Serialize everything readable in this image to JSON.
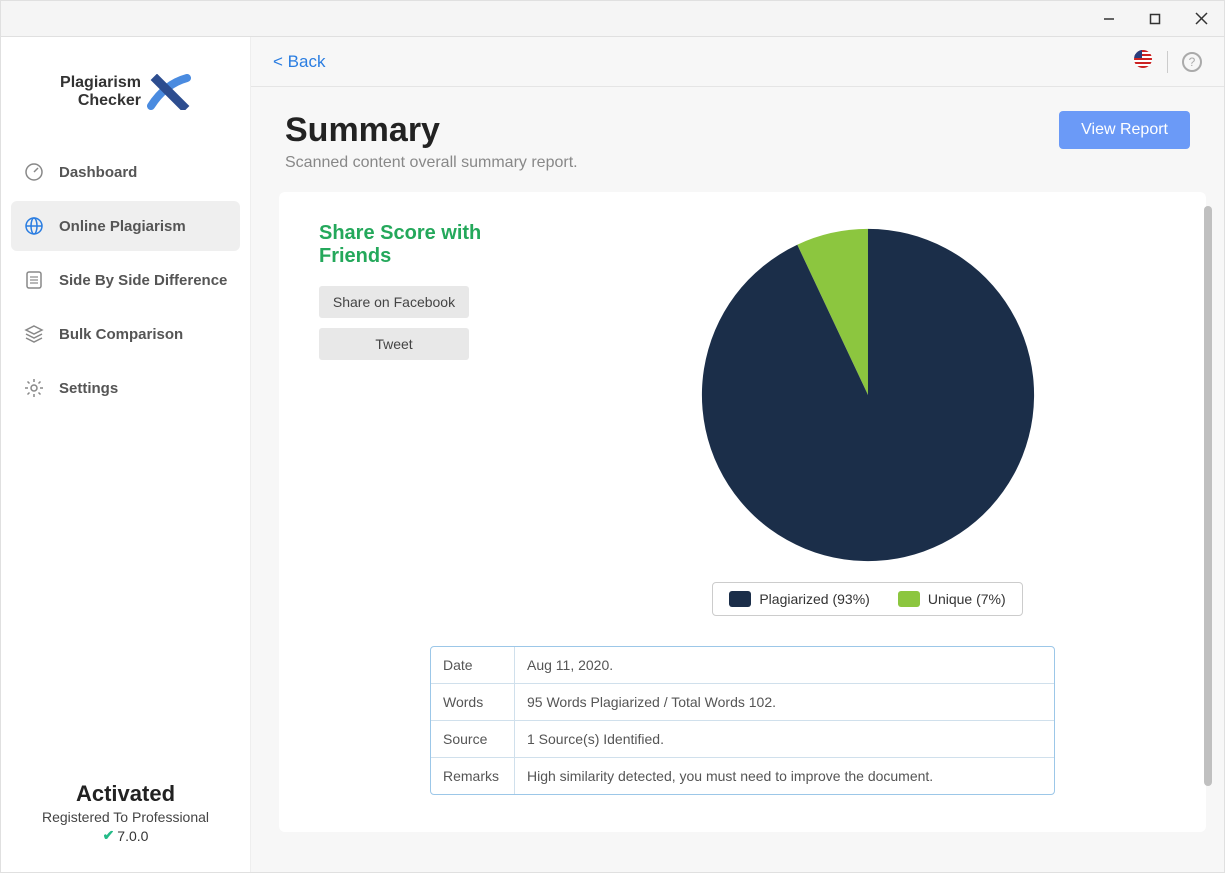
{
  "brand": {
    "line1": "Plagiarism",
    "line2": "Checker"
  },
  "sidebar": {
    "items": [
      {
        "label": "Dashboard"
      },
      {
        "label": "Online Plagiarism"
      },
      {
        "label": "Side By Side Difference"
      },
      {
        "label": "Bulk Comparison"
      },
      {
        "label": "Settings"
      }
    ]
  },
  "status": {
    "activated": "Activated",
    "registered": "Registered To Professional",
    "version": "7.0.0"
  },
  "topbar": {
    "back": "< Back"
  },
  "header": {
    "title": "Summary",
    "subtitle": "Scanned content overall summary report.",
    "view_report": "View Report"
  },
  "share": {
    "title": "Share Score with Friends",
    "fb": "Share on Facebook",
    "tw": "Tweet"
  },
  "chart_data": {
    "type": "pie",
    "title": "",
    "slices": [
      {
        "label": "Plagiarized",
        "value": 93,
        "color": "#1b2e49"
      },
      {
        "label": "Unique",
        "value": 7,
        "color": "#8cc63f"
      }
    ],
    "legend": [
      "Plagiarized (93%)",
      "Unique (7%)"
    ]
  },
  "table": [
    {
      "label": "Date",
      "value": "Aug 11, 2020."
    },
    {
      "label": "Words",
      "value": "95 Words Plagiarized / Total Words 102."
    },
    {
      "label": "Source",
      "value": "1 Source(s) Identified."
    },
    {
      "label": "Remarks",
      "value": "High similarity detected, you must need to improve the document."
    }
  ]
}
